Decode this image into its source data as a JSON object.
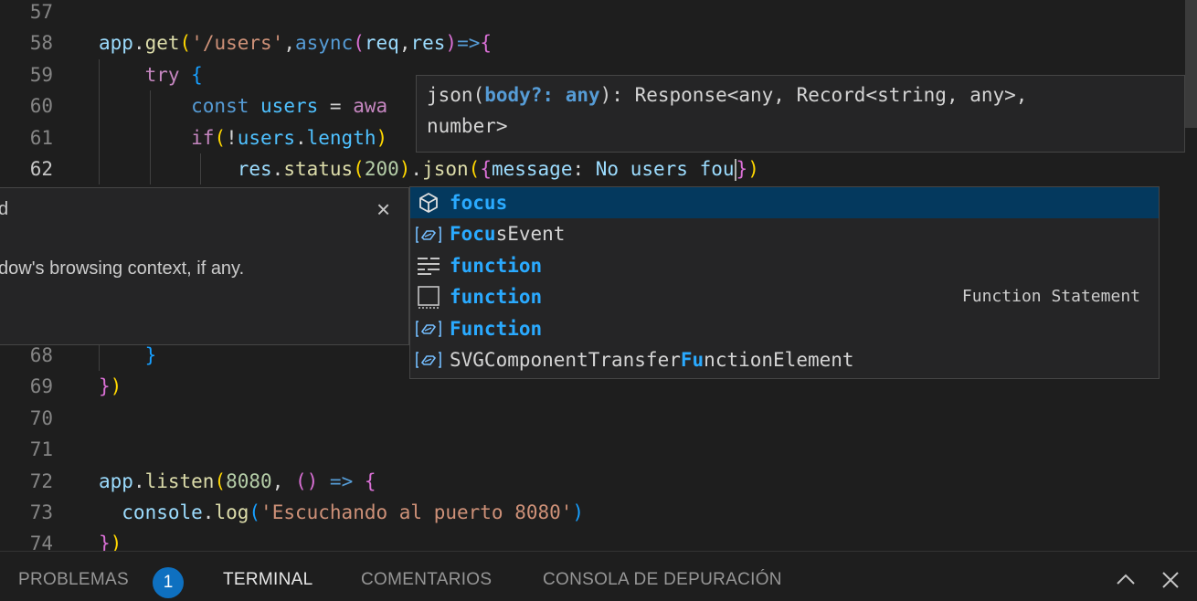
{
  "editor": {
    "lines": [
      {
        "num": "57",
        "active": false,
        "tokens": []
      },
      {
        "num": "58",
        "active": false,
        "tokens": [
          {
            "t": "app",
            "c": "pl"
          },
          {
            "t": ".",
            "c": "tx"
          },
          {
            "t": "get",
            "c": "fn"
          },
          {
            "t": "(",
            "c": "b1"
          },
          {
            "t": "'/users'",
            "c": "st"
          },
          {
            "t": ",",
            "c": "tx"
          },
          {
            "t": "async",
            "c": "bl"
          },
          {
            "t": "(",
            "c": "b2"
          },
          {
            "t": "req",
            "c": "pl"
          },
          {
            "t": ",",
            "c": "tx"
          },
          {
            "t": "res",
            "c": "pl"
          },
          {
            "t": ")",
            "c": "b2"
          },
          {
            "t": "=>",
            "c": "bl"
          },
          {
            "t": "{",
            "c": "b2"
          }
        ]
      },
      {
        "num": "59",
        "active": false,
        "tokens": [
          {
            "t": "    try",
            "c": "kw"
          },
          {
            "t": " ",
            "c": "tx"
          },
          {
            "t": "{",
            "c": "b3"
          }
        ]
      },
      {
        "num": "60",
        "active": false,
        "tokens": [
          {
            "t": "        const",
            "c": "bl"
          },
          {
            "t": " ",
            "c": "tx"
          },
          {
            "t": "users",
            "c": "cst"
          },
          {
            "t": " = ",
            "c": "tx"
          },
          {
            "t": "awa",
            "c": "kw"
          }
        ]
      },
      {
        "num": "61",
        "active": false,
        "tokens": [
          {
            "t": "        if",
            "c": "kw"
          },
          {
            "t": "(",
            "c": "b1"
          },
          {
            "t": "!",
            "c": "tx"
          },
          {
            "t": "users",
            "c": "cst"
          },
          {
            "t": ".",
            "c": "tx"
          },
          {
            "t": "length",
            "c": "cst"
          },
          {
            "t": ")",
            "c": "b1"
          }
        ]
      },
      {
        "num": "62",
        "active": true,
        "tokens": [
          {
            "t": "            res",
            "c": "pl"
          },
          {
            "t": ".",
            "c": "tx"
          },
          {
            "t": "status",
            "c": "fn"
          },
          {
            "t": "(",
            "c": "b1"
          },
          {
            "t": "200",
            "c": "nm"
          },
          {
            "t": ")",
            "c": "b1"
          },
          {
            "t": ".",
            "c": "tx"
          },
          {
            "t": "json",
            "c": "fn"
          },
          {
            "t": "(",
            "c": "b1"
          },
          {
            "t": "{",
            "c": "b2"
          },
          {
            "t": "message",
            "c": "pl"
          },
          {
            "t": ": ",
            "c": "tx"
          },
          {
            "t": "No",
            "c": "pl"
          },
          {
            "t": " ",
            "c": "tx"
          },
          {
            "t": "users",
            "c": "pl"
          },
          {
            "t": " ",
            "c": "tx"
          },
          {
            "t": "fou",
            "c": "pl"
          },
          {
            "t": "CURSOR",
            "c": "cur"
          },
          {
            "t": "}",
            "c": "b2"
          },
          {
            "t": ")",
            "c": "b1"
          }
        ]
      },
      {
        "num": "68",
        "active": false,
        "tokens": [
          {
            "t": "    }",
            "c": "b3"
          }
        ]
      },
      {
        "num": "69",
        "active": false,
        "tokens": [
          {
            "t": "}",
            "c": "b2"
          },
          {
            "t": ")",
            "c": "b1"
          }
        ]
      },
      {
        "num": "70",
        "active": false,
        "tokens": []
      },
      {
        "num": "71",
        "active": false,
        "tokens": []
      },
      {
        "num": "72",
        "active": false,
        "tokens": [
          {
            "t": "app",
            "c": "pl"
          },
          {
            "t": ".",
            "c": "tx"
          },
          {
            "t": "listen",
            "c": "fn"
          },
          {
            "t": "(",
            "c": "b1"
          },
          {
            "t": "8080",
            "c": "nm"
          },
          {
            "t": ", ",
            "c": "tx"
          },
          {
            "t": "()",
            "c": "b2"
          },
          {
            "t": " => ",
            "c": "bl"
          },
          {
            "t": "{",
            "c": "b2"
          }
        ]
      },
      {
        "num": "73",
        "active": false,
        "tokens": [
          {
            "t": "  console",
            "c": "pl"
          },
          {
            "t": ".",
            "c": "tx"
          },
          {
            "t": "log",
            "c": "fn"
          },
          {
            "t": "(",
            "c": "b3"
          },
          {
            "t": "'Escuchando al puerto 8080'",
            "c": "st"
          },
          {
            "t": ")",
            "c": "b3"
          }
        ]
      },
      {
        "num": "74",
        "active": false,
        "tokens": [
          {
            "t": "}",
            "c": "b2"
          },
          {
            "t": ")",
            "c": "b1"
          }
        ]
      }
    ]
  },
  "hover": {
    "name": "json(",
    "param": "body?: any",
    "rest": "): Response<any, Record<string, any>,",
    "line2": "number>"
  },
  "details": {
    "title": "d",
    "description": "dow's browsing context, if any.",
    "close_glyph": "×"
  },
  "suggest": {
    "items": [
      {
        "pre": "",
        "match": "focus",
        "post": "",
        "icon": "cube-icon",
        "selected": true,
        "detail": ""
      },
      {
        "pre": "",
        "match": "Focu",
        "post": "sEvent",
        "icon": "interface-icon",
        "selected": false,
        "detail": ""
      },
      {
        "pre": "",
        "match": "function",
        "post": "",
        "icon": "keyword-icon",
        "selected": false,
        "detail": ""
      },
      {
        "pre": "",
        "match": "function",
        "post": "",
        "icon": "snippet-icon",
        "selected": false,
        "detail": "Function Statement"
      },
      {
        "pre": "",
        "match": "Function",
        "post": "",
        "icon": "interface-icon",
        "selected": false,
        "detail": ""
      },
      {
        "pre": "SVGComponentTransfer",
        "match": "Fu",
        "post": "nctionElement",
        "icon": "interface-icon",
        "selected": false,
        "detail": ""
      }
    ]
  },
  "panel": {
    "tabs": [
      "PROBLEMAS",
      "TERMINAL",
      "COMENTARIOS",
      "CONSOLA DE DEPURACIÓN"
    ],
    "problems_count": "1"
  }
}
